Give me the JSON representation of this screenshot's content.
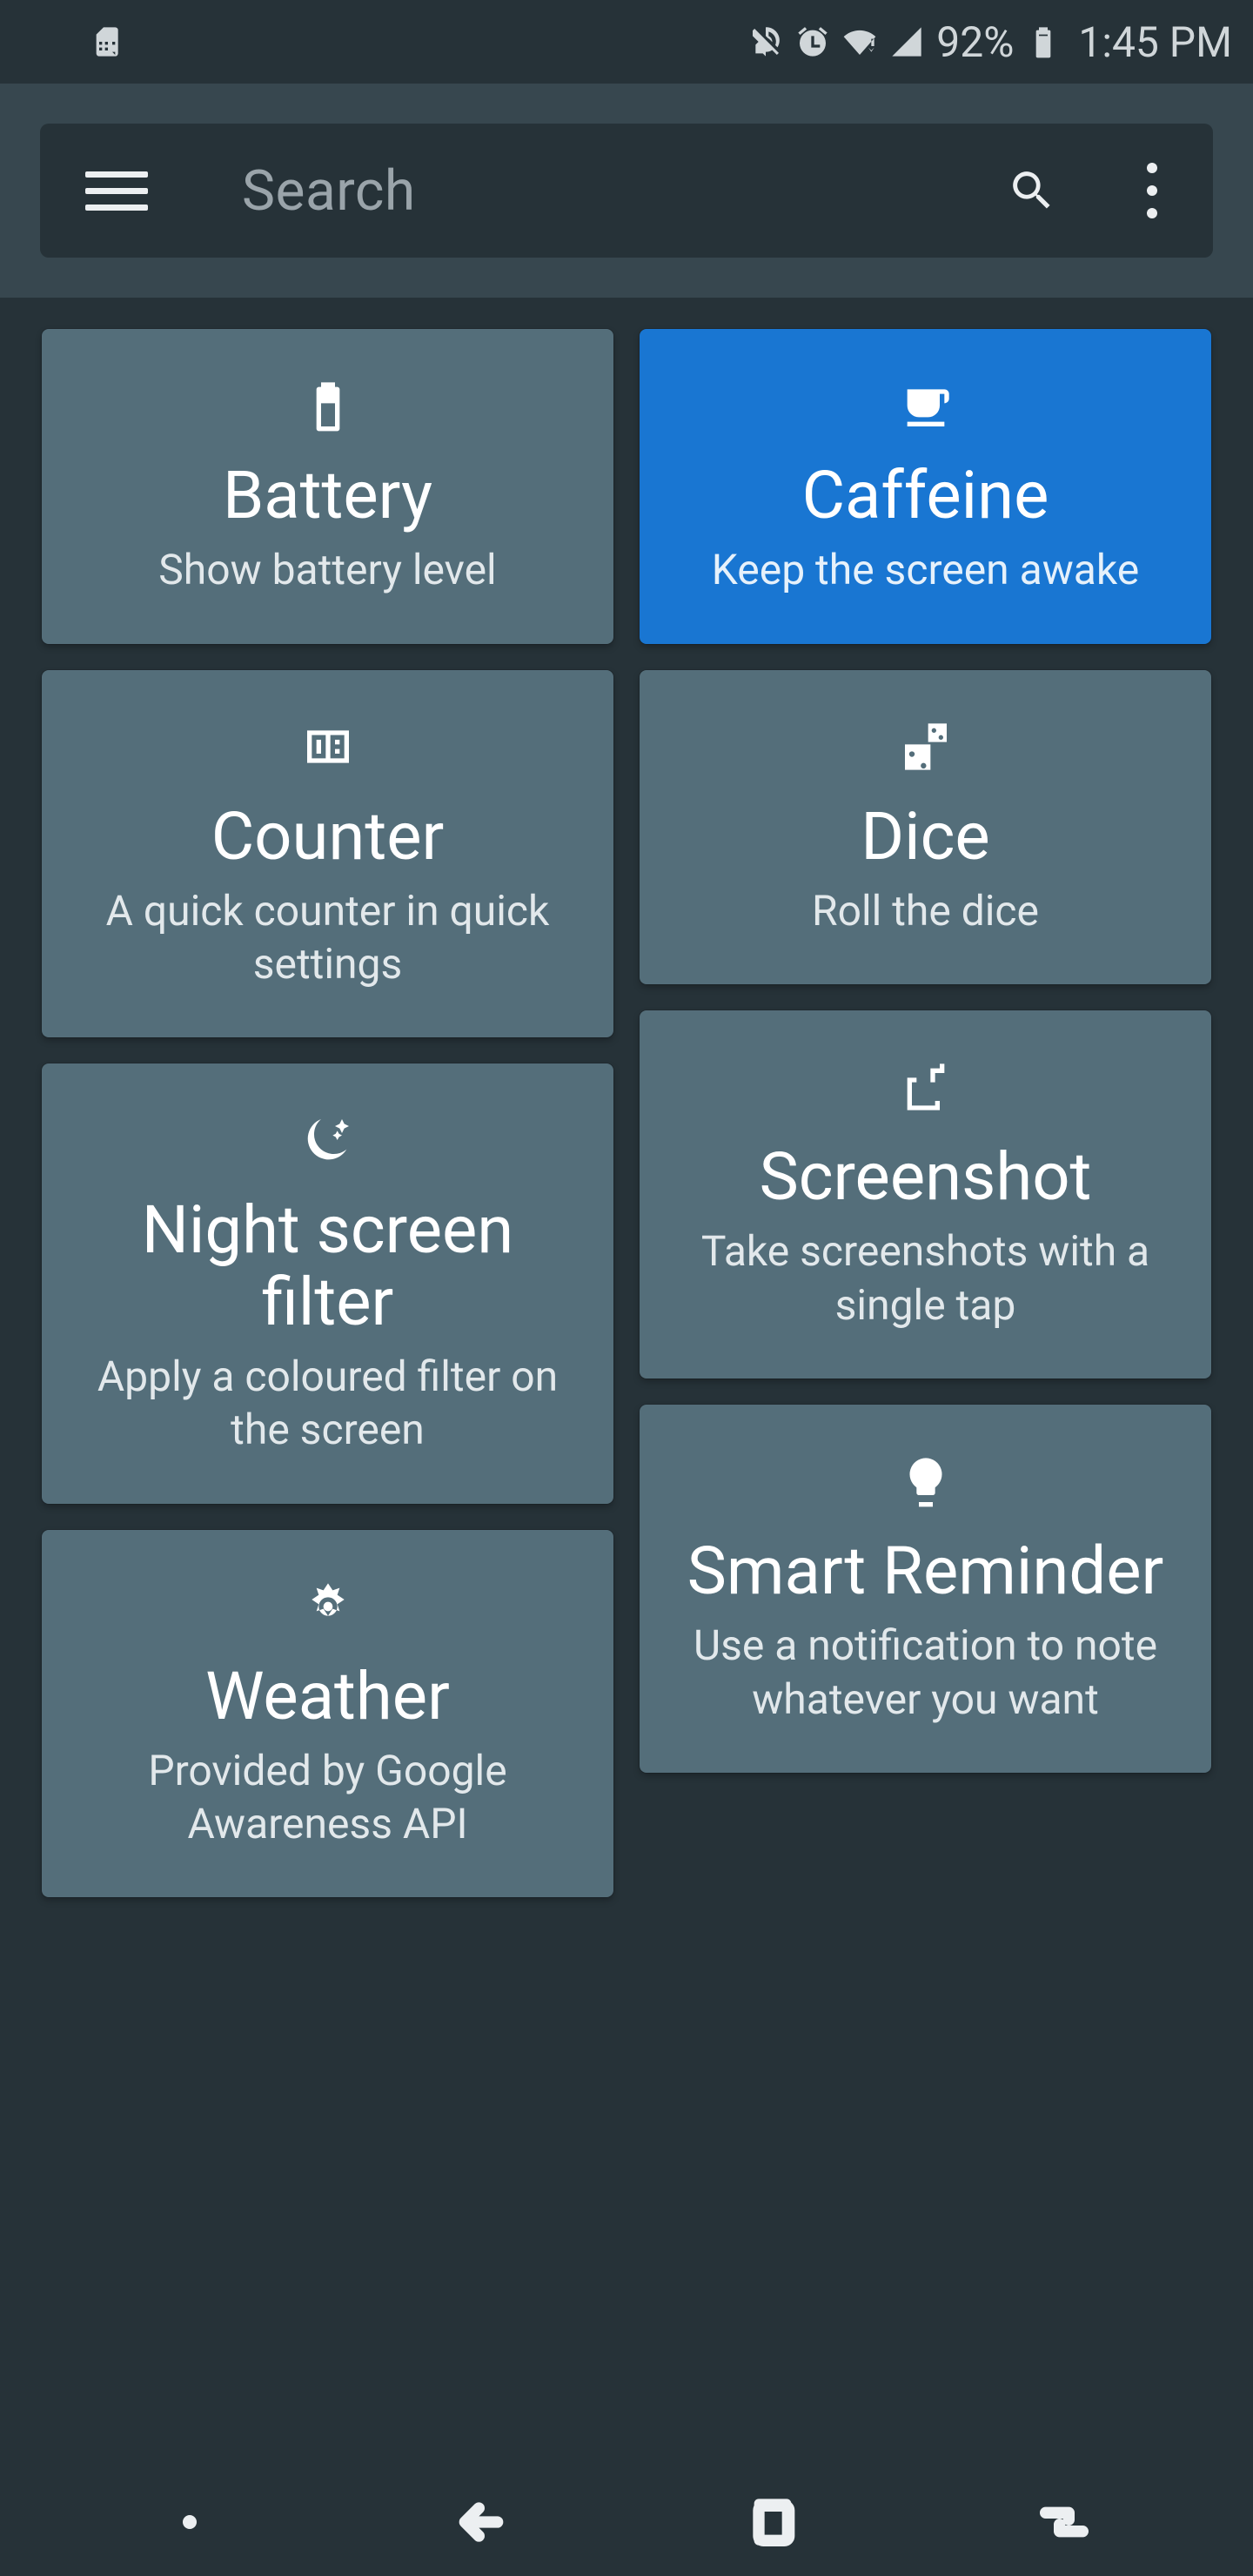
{
  "status": {
    "battery_pct": "92%",
    "time": "1:45 PM"
  },
  "toolbar": {
    "search_placeholder": "Search"
  },
  "tiles": {
    "battery": {
      "title": "Battery",
      "desc": "Show battery level"
    },
    "caffeine": {
      "title": "Caffeine",
      "desc": "Keep the screen awake"
    },
    "counter": {
      "title": "Counter",
      "desc": "A quick counter in quick settings"
    },
    "dice": {
      "title": "Dice",
      "desc": "Roll the dice"
    },
    "night": {
      "title": "Night screen filter",
      "desc": "Apply a coloured filter on the screen"
    },
    "screenshot": {
      "title": "Screenshot",
      "desc": "Take screenshots with a single tap"
    },
    "weather": {
      "title": "Weather",
      "desc": "Provided by Google Awareness API"
    },
    "reminder": {
      "title": "Smart Reminder",
      "desc": "Use a notification to note whatever you want"
    }
  }
}
